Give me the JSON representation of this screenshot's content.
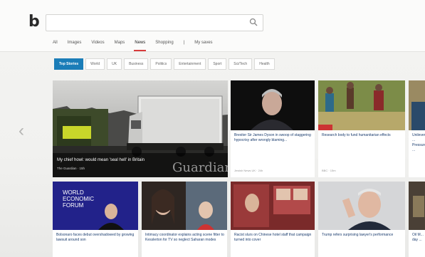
{
  "header": {
    "logo": "b",
    "search_value": "",
    "nav_items": [
      "All",
      "Images",
      "Videos",
      "Maps",
      "News",
      "Shopping",
      "|",
      "My saves"
    ],
    "active_nav": "News"
  },
  "categories": [
    "Top Stories",
    "World",
    "UK",
    "Business",
    "Politics",
    "Entertainment",
    "Sport",
    "Sci/Tech",
    "Health"
  ],
  "hero": {
    "title": "My chief howl: would mean 'seal hell' in Britain",
    "meta": "The Guardian · 15h",
    "watermark": "Guardian"
  },
  "top_cards": [
    {
      "title": "Brexiter Sir James Dyson in swoop of staggering hypocrisy after wrongly blaming...",
      "meta": "Jewish News UK · 24h"
    },
    {
      "title": "Research body to fund humanitarian effects",
      "meta": "BBC · 15m"
    },
    {
      "title": "Unilever ... Pressure ..."
    }
  ],
  "bottom_cards": [
    {
      "title": "Bolsonaro faces debut overshadowed by growing lawsuit around son"
    },
    {
      "title": "Intimacy coordinator explains acting scene fitter to Kesslerton for TV so neglect Saharan modes"
    },
    {
      "title": "Racist slurs on Chinese hotel staff that campaign turned into cover"
    },
    {
      "title": "Trump refers surprising lawyer's performance"
    },
    {
      "title": "Oil M... day ..."
    }
  ],
  "colors": {
    "accent": "#1b7db8",
    "nav_underline": "#d83b3b",
    "headline": "#1a3c6e"
  }
}
